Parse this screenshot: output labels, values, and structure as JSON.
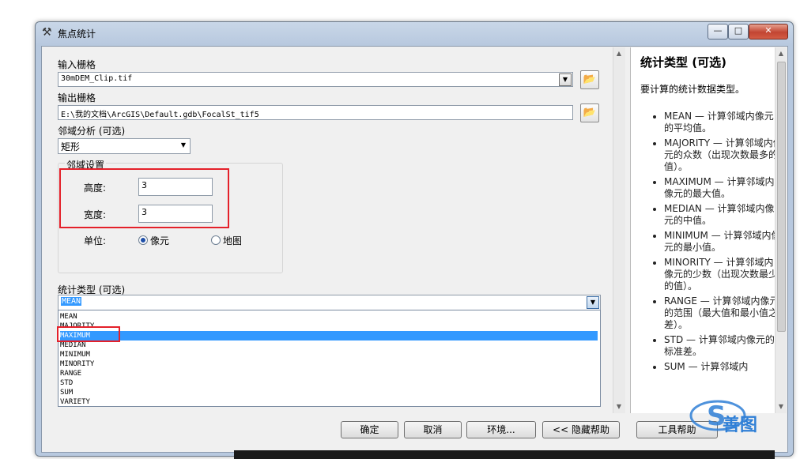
{
  "window": {
    "title": "焦点统计",
    "close_glyph": "✕",
    "min_glyph": "—",
    "max_glyph": "□"
  },
  "form": {
    "input_raster": {
      "label": "输入栅格",
      "value": "30mDEM_Clip.tif"
    },
    "output_raster": {
      "label": "输出栅格",
      "value": "E:\\我的文档\\ArcGIS\\Default.gdb\\FocalSt_tif5"
    },
    "neighborhood": {
      "label": "邻域分析 (可选)",
      "value": "矩形"
    },
    "neighborhood_settings": {
      "group_label": "邻域设置",
      "height_label": "高度:",
      "height_value": "3",
      "width_label": "宽度:",
      "width_value": "3",
      "units_label": "单位:",
      "unit_cell": "像元",
      "unit_map": "地图"
    },
    "statistics_type": {
      "label": "统计类型 (可选)",
      "value": "MEAN",
      "options": [
        "MEAN",
        "MAJORITY",
        "MAXIMUM",
        "MEDIAN",
        "MINIMUM",
        "MINORITY",
        "RANGE",
        "STD",
        "SUM",
        "VARIETY"
      ],
      "highlighted": "MAXIMUM"
    }
  },
  "help": {
    "title": "统计类型 (可选)",
    "description": "要计算的统计数据类型。",
    "items": [
      "MEAN — 计算邻域内像元的平均值。",
      "MAJORITY — 计算邻域内像元的众数（出现次数最多的值）。",
      "MAXIMUM — 计算邻域内像元的最大值。",
      "MEDIAN — 计算邻域内像元的中值。",
      "MINIMUM — 计算邻域内像元的最小值。",
      "MINORITY — 计算邻域内像元的少数（出现次数最少的值）。",
      "RANGE — 计算邻域内像元的范围（最大值和最小值之差）。",
      "STD — 计算邻域内像元的标准差。",
      "SUM — 计算邻域内"
    ]
  },
  "buttons": {
    "ok": "确定",
    "cancel": "取消",
    "environments": "环境...",
    "hide_help": "<< 隐藏帮助",
    "tool_help": "工具帮助"
  },
  "watermark": {
    "text": "善图",
    "logo_letter": "S"
  },
  "colors": {
    "highlight": "#3399ff",
    "annotation": "#e4202a",
    "watermark": "#2f7fd6"
  }
}
